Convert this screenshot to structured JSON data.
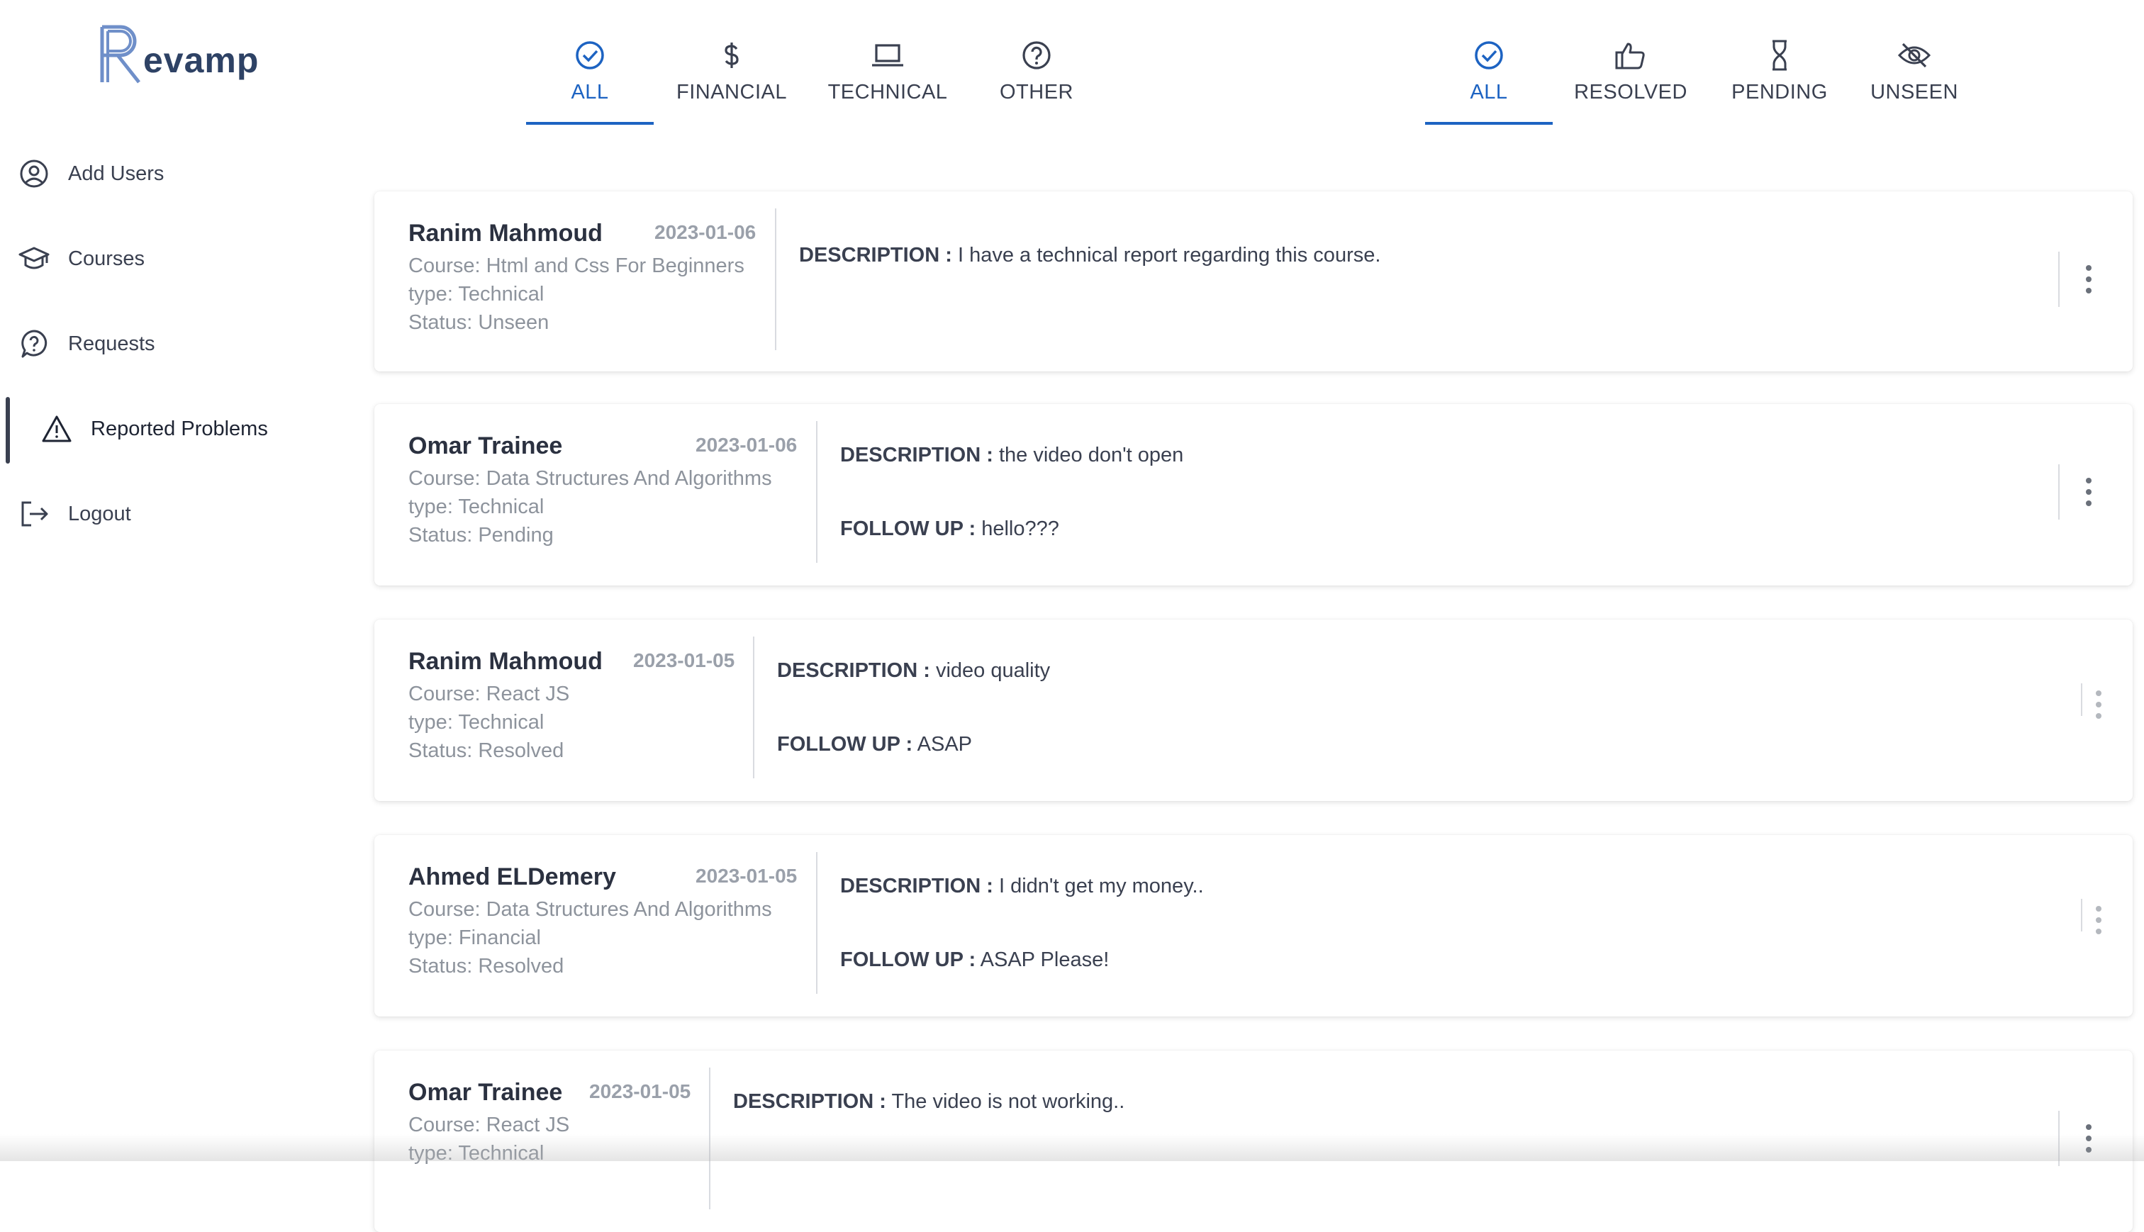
{
  "logo": {
    "text": "evamp",
    "icon": "revamp-r-logo"
  },
  "sidebar": {
    "items": [
      {
        "label": "Add Users",
        "icon": "user-circle-icon"
      },
      {
        "label": "Courses",
        "icon": "graduation-cap-icon"
      },
      {
        "label": "Requests",
        "icon": "question-bubble-icon"
      },
      {
        "label": "Reported Problems",
        "icon": "warning-triangle-icon",
        "active": true
      },
      {
        "label": "Logout",
        "icon": "logout-icon"
      }
    ]
  },
  "type_tabs": [
    {
      "label": "ALL",
      "icon": "check-circle-icon",
      "selected": true
    },
    {
      "label": "FINANCIAL",
      "icon": "dollar-icon"
    },
    {
      "label": "TECHNICAL",
      "icon": "laptop-icon"
    },
    {
      "label": "OTHER",
      "icon": "question-circle-icon"
    }
  ],
  "status_tabs": [
    {
      "label": "ALL",
      "icon": "check-circle-icon",
      "selected": true
    },
    {
      "label": "RESOLVED",
      "icon": "thumbs-up-icon"
    },
    {
      "label": "PENDING",
      "icon": "hourglass-icon"
    },
    {
      "label": "UNSEEN",
      "icon": "eye-off-icon"
    }
  ],
  "labels": {
    "description": "DESCRIPTION :",
    "follow_up": "FOLLOW UP :"
  },
  "problems": [
    {
      "name": "Ranim Mahmoud",
      "date": "2023-01-06",
      "course": "Course: Html and Css For Beginners",
      "type": "type: Technical",
      "status": "Status: Unseen",
      "description": "I have a technical report regarding this course.",
      "follow_up": ""
    },
    {
      "name": "Omar Trainee",
      "date": "2023-01-06",
      "course": "Course: Data Structures And Algorithms",
      "type": "type: Technical",
      "status": "Status: Pending",
      "description": "the video don't open",
      "follow_up": "hello???"
    },
    {
      "name": "Ranim Mahmoud",
      "date": "2023-01-05",
      "course": "Course: React JS",
      "type": "type: Technical",
      "status": "Status: Resolved",
      "description": "video quality",
      "follow_up": "ASAP"
    },
    {
      "name": "Ahmed ELDemery",
      "date": "2023-01-05",
      "course": "Course: Data Structures And Algorithms",
      "type": "type: Financial",
      "status": "Status: Resolved",
      "description": "I didn't get my money..",
      "follow_up": "ASAP Please!"
    },
    {
      "name": "Omar Trainee",
      "date": "2023-01-05",
      "course": "Course: React JS",
      "type": "type: Technical",
      "status": "",
      "description": "The video is not working..",
      "follow_up": ""
    }
  ],
  "colors": {
    "accent": "#1d63c2",
    "text": "#3a4050",
    "muted": "#8d939c"
  }
}
